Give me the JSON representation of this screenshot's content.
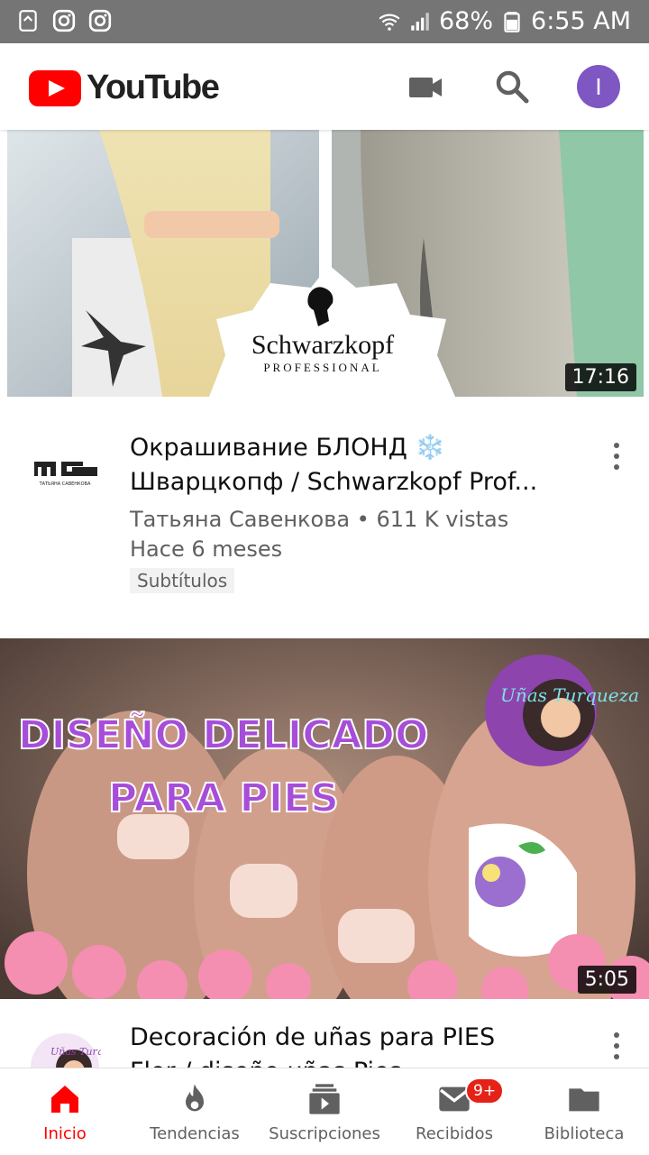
{
  "status_bar": {
    "battery": "68%",
    "time": "6:55 AM",
    "left_icons": [
      "recycle-notif-icon",
      "instagram-icon",
      "instagram-icon"
    ],
    "right_icons": [
      "wifi-icon",
      "signal-icon",
      "battery-icon"
    ]
  },
  "app_bar": {
    "logo_text": "YouTube",
    "avatar_letter": "I",
    "icons": [
      "camera-icon",
      "search-icon"
    ]
  },
  "videos": [
    {
      "thumbnail_text": "Schwarzkopf",
      "thumbnail_subtext": "PROFESSIONAL",
      "duration": "17:16",
      "title": "Окрашивание БЛОНД ❄️ Шварцкопф / Schwarzkopf Prof...",
      "title_line1": "Окрашивание БЛОНД ❄️",
      "title_line2": "Шварцкопф / Schwarzkopf Prof...",
      "channel_line": "Татьяна Савенкова • 611 K vistas",
      "age": "Hace 6 meses",
      "badge": "Subtítulos",
      "channel_avatar_text": "ТАТЬЯНА САВЕНКОВА"
    },
    {
      "thumbnail_line1": "DISEÑO DELICADO",
      "thumbnail_line2": "PARA PIES",
      "thumbnail_logo": "Uñas Turqueza",
      "duration": "5:05",
      "title_line1": "Decoración de uñas para PIES",
      "title_line2": "Flor / diseño uñas Pies",
      "channel_avatar_text": "Uñas Turqueza"
    }
  ],
  "bottom_nav": [
    {
      "label": "Inicio",
      "icon": "home-icon",
      "active": true
    },
    {
      "label": "Tendencias",
      "icon": "flame-icon",
      "active": false
    },
    {
      "label": "Suscripciones",
      "icon": "subscriptions-icon",
      "active": false
    },
    {
      "label": "Recibidos",
      "icon": "inbox-icon",
      "active": false,
      "badge": "9+"
    },
    {
      "label": "Biblioteca",
      "icon": "folder-icon",
      "active": false
    }
  ],
  "colors": {
    "accent": "#ff0000",
    "avatar": "#7e57c2",
    "status_bar": "#757575",
    "thumbnail_title_purple": "#a64dd9"
  }
}
